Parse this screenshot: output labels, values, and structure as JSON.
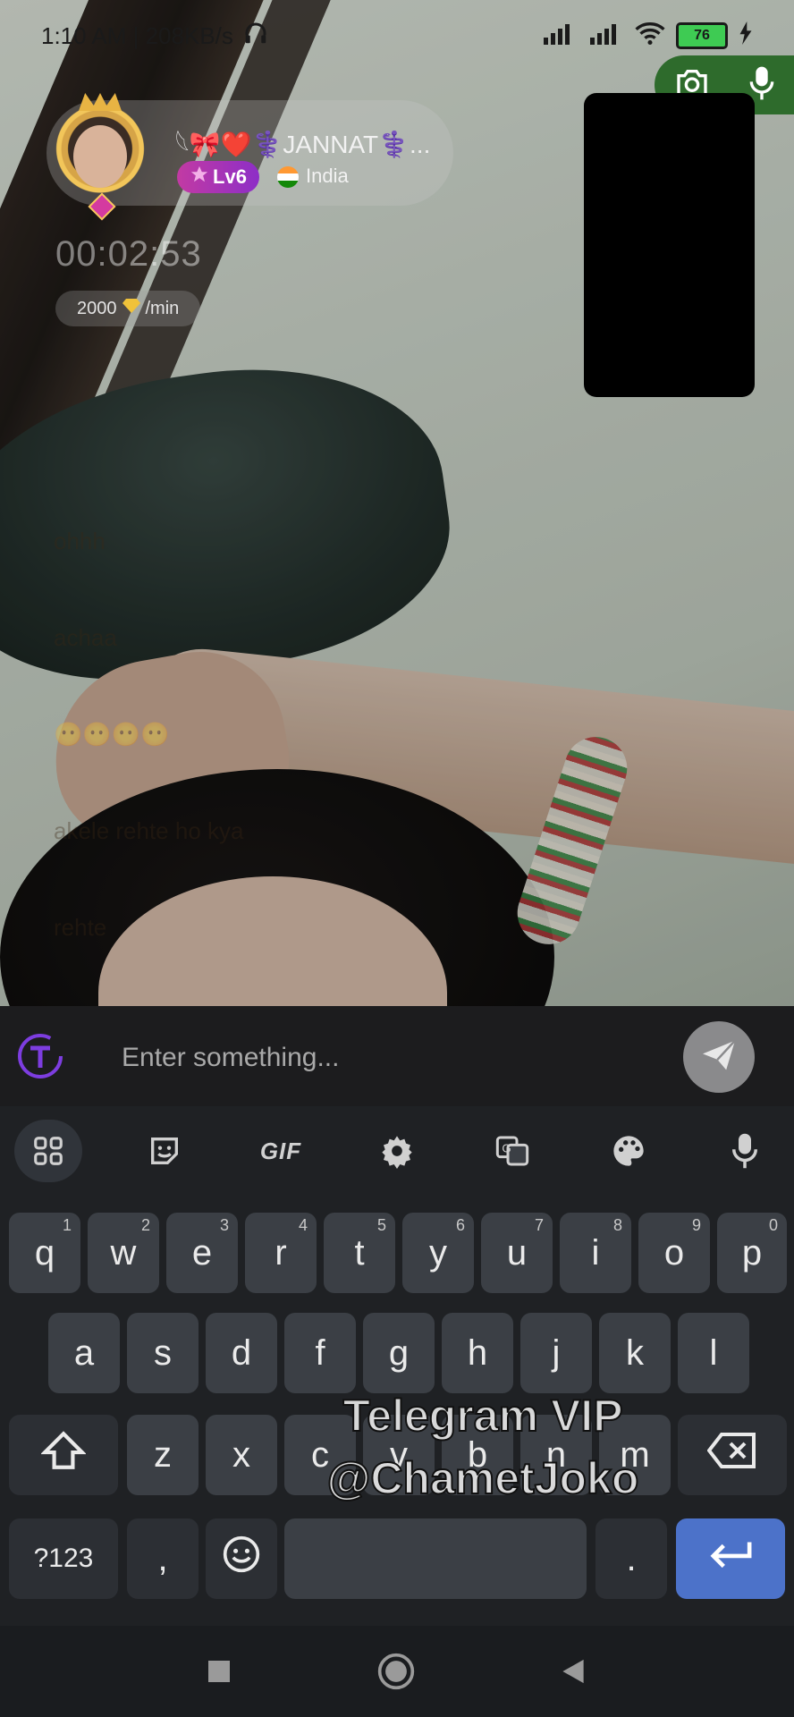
{
  "status_bar": {
    "time_speed": "1:10 AM | 208KB/s",
    "battery": "76"
  },
  "call": {
    "username": "𓆩🎀❤️⚕️JANNAT⚕️...",
    "level": "Lv6",
    "country": "India",
    "timer": "00:02:53",
    "rate_value": "2000",
    "rate_unit": "/min"
  },
  "chat": {
    "messages": [
      "ohhh",
      "achaa",
      "😶😶😶😶",
      "akele rehte ho kya",
      "rehte"
    ]
  },
  "composer": {
    "placeholder": "Enter something..."
  },
  "keyboard": {
    "toolbar": {
      "gif_label": "GIF"
    },
    "row1": [
      {
        "k": "q",
        "h": "1"
      },
      {
        "k": "w",
        "h": "2"
      },
      {
        "k": "e",
        "h": "3"
      },
      {
        "k": "r",
        "h": "4"
      },
      {
        "k": "t",
        "h": "5"
      },
      {
        "k": "y",
        "h": "6"
      },
      {
        "k": "u",
        "h": "7"
      },
      {
        "k": "i",
        "h": "8"
      },
      {
        "k": "o",
        "h": "9"
      },
      {
        "k": "p",
        "h": "0"
      }
    ],
    "row2": [
      "a",
      "s",
      "d",
      "f",
      "g",
      "h",
      "j",
      "k",
      "l"
    ],
    "row3": [
      "z",
      "x",
      "c",
      "v",
      "b",
      "n",
      "m"
    ],
    "symbols_label": "?123",
    "comma_label": ",",
    "period_label": "."
  },
  "watermark": {
    "line1": "Telegram VIP",
    "line2": "@ChametJoko"
  }
}
